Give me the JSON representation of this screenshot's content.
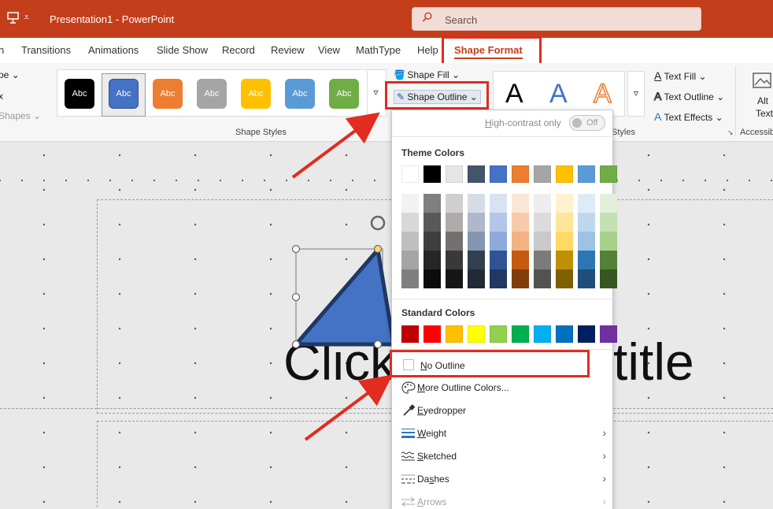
{
  "window": {
    "title": "Presentation1  -  PowerPoint",
    "search_placeholder": "Search"
  },
  "tabs": [
    {
      "label": "n"
    },
    {
      "label": "Transitions"
    },
    {
      "label": "Animations"
    },
    {
      "label": "Slide Show"
    },
    {
      "label": "Record"
    },
    {
      "label": "Review"
    },
    {
      "label": "View"
    },
    {
      "label": "MathType"
    },
    {
      "label": "Help"
    },
    {
      "label": "Shape Format"
    }
  ],
  "ribbon": {
    "left_cut": {
      "item1": "pe",
      "item2": "x",
      "item3": "Shapes"
    },
    "shape_styles": {
      "label": "Shape Styles",
      "swatches": [
        {
          "text": "Abc",
          "fill": "#000000"
        },
        {
          "text": "Abc",
          "fill": "#4472c4"
        },
        {
          "text": "Abc",
          "fill": "#ed7d31"
        },
        {
          "text": "Abc",
          "fill": "#a5a5a5"
        },
        {
          "text": "Abc",
          "fill": "#ffc000"
        },
        {
          "text": "Abc",
          "fill": "#5b9bd5"
        },
        {
          "text": "Abc",
          "fill": "#70ad47"
        }
      ]
    },
    "shape_fill": "Shape Fill",
    "shape_outline": "Shape Outline",
    "wordart": {
      "label": "Styles",
      "letter": "A"
    },
    "text_fill": "Text Fill",
    "text_outline": "Text Outline",
    "text_effects": "Text Effects",
    "alt_text_line1": "Alt",
    "alt_text_line2": "Text",
    "accessibility": "Accessib"
  },
  "menu": {
    "high_contrast": "High-contrast only",
    "toggle_state": "Off",
    "theme_colors_title": "Theme Colors",
    "standard_colors_title": "Standard Colors",
    "theme_top": [
      "#ffffff",
      "#000000",
      "#e7e6e6",
      "#44546a",
      "#4472c4",
      "#ed7d31",
      "#a5a5a5",
      "#ffc000",
      "#5b9bd5",
      "#70ad47"
    ],
    "theme_shades": [
      [
        "#f2f2f2",
        "#7f7f7f",
        "#d0cece",
        "#d6dce4",
        "#d9e2f3",
        "#fbe5d5",
        "#ededed",
        "#fff2cc",
        "#ddebf7",
        "#e2efd9"
      ],
      [
        "#d8d8d8",
        "#595959",
        "#aeabab",
        "#adb9ca",
        "#b4c6e7",
        "#f7caac",
        "#dbdbdb",
        "#fee599",
        "#bdd7ee",
        "#c5e0b3"
      ],
      [
        "#bfbfbf",
        "#3f3f3f",
        "#757070",
        "#8496b0",
        "#8eaadb",
        "#f4b183",
        "#c9c9c9",
        "#ffd965",
        "#9cc3e5",
        "#a8d08d"
      ],
      [
        "#a5a5a5",
        "#262626",
        "#3a3838",
        "#323f4f",
        "#2f5496",
        "#c55a11",
        "#7b7b7b",
        "#bf9000",
        "#2e75b5",
        "#538135"
      ],
      [
        "#7f7f7f",
        "#0c0c0c",
        "#171616",
        "#222a35",
        "#1f3864",
        "#833c0b",
        "#525252",
        "#7f6000",
        "#1e4e79",
        "#375623"
      ]
    ],
    "standard": [
      "#c00000",
      "#ff0000",
      "#ffc000",
      "#ffff00",
      "#92d050",
      "#00b050",
      "#00b0f0",
      "#0070c0",
      "#002060",
      "#7030a0"
    ],
    "no_outline": "No Outline",
    "more_colors": "More Outline Colors...",
    "eyedropper": "Eyedropper",
    "weight": "Weight",
    "sketched": "Sketched",
    "dashes": "Dashes",
    "arrows": "Arrows"
  },
  "slide": {
    "title_left": "Click",
    "title_right": "title"
  },
  "colors": {
    "accent": "#c43e1c",
    "highlight": "#e12c1f",
    "shape_fill": "#4472c4",
    "shape_outline": "#1f3864"
  }
}
